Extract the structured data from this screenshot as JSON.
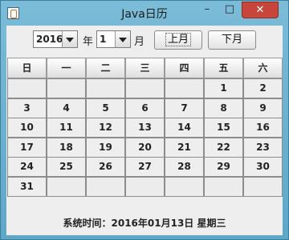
{
  "window": {
    "title": "Java日历",
    "minimize": "–",
    "maximize": "□",
    "close": "✕"
  },
  "controls": {
    "year_value": "2016",
    "year_unit": "年",
    "month_value": "1",
    "month_unit": "月",
    "prev_month": "上月",
    "next_month": "下月"
  },
  "calendar": {
    "weekdays": [
      "日",
      "一",
      "二",
      "三",
      "四",
      "五",
      "六"
    ],
    "weeks": [
      [
        "",
        "",
        "",
        "",
        "",
        "1",
        "2"
      ],
      [
        "3",
        "4",
        "5",
        "6",
        "7",
        "8",
        "9"
      ],
      [
        "10",
        "11",
        "12",
        "13",
        "14",
        "15",
        "16"
      ],
      [
        "17",
        "18",
        "19",
        "20",
        "21",
        "22",
        "23"
      ],
      [
        "24",
        "25",
        "26",
        "27",
        "28",
        "29",
        "30"
      ],
      [
        "31",
        "",
        "",
        "",
        "",
        "",
        ""
      ]
    ]
  },
  "status": {
    "text": "系统时间：2016年01月13日 星期三"
  }
}
